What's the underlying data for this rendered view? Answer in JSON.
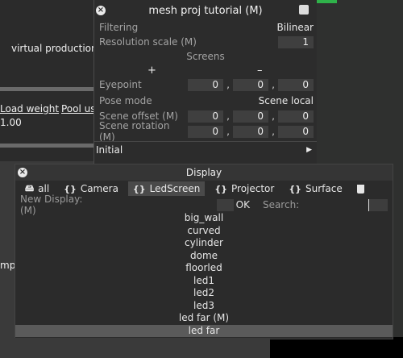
{
  "left_panel": {
    "virtual_production": "virtual production",
    "load_weight": "Load weight",
    "pool_us": "Pool us",
    "value": "1.00",
    "mp": "mp"
  },
  "mesh_window": {
    "title": "mesh proj tutorial (M)",
    "filtering_label": "Filtering",
    "filtering_value": "Bilinear",
    "resolution_label": "Resolution scale (M)",
    "resolution_value": "1",
    "screens_label": "Screens",
    "plus": "+",
    "minus": "–",
    "eyepoint_label": "Eyepoint",
    "eyepoint": [
      "0",
      "0",
      "0"
    ],
    "pose_mode_label": "Pose mode",
    "pose_mode_value": "Scene local",
    "scene_offset_label": "Scene offset (M)",
    "scene_offset": [
      "0",
      "0",
      "0"
    ],
    "scene_rotation_label": "Scene rotation (M)",
    "scene_rotation": [
      "0",
      "0",
      "0"
    ],
    "initial_label": "Initial",
    "sep": ","
  },
  "display_window": {
    "title": "Display",
    "tabs": [
      {
        "icon": "🖴",
        "label": "all"
      },
      {
        "icon": "{}",
        "label": "Camera"
      },
      {
        "icon": "{}",
        "label": "LedScreen"
      },
      {
        "icon": "{}",
        "label": "Projector"
      },
      {
        "icon": "{}",
        "label": "Surface"
      }
    ],
    "new_display_label": "New Display: (M)",
    "ok_label": "OK",
    "search_label": "Search:",
    "items": [
      "big_wall",
      "curved",
      "cylinder",
      "dome",
      "floorled",
      "led1",
      "led2",
      "led3",
      "led far (M)",
      "led far"
    ],
    "selected_item": "led far"
  }
}
